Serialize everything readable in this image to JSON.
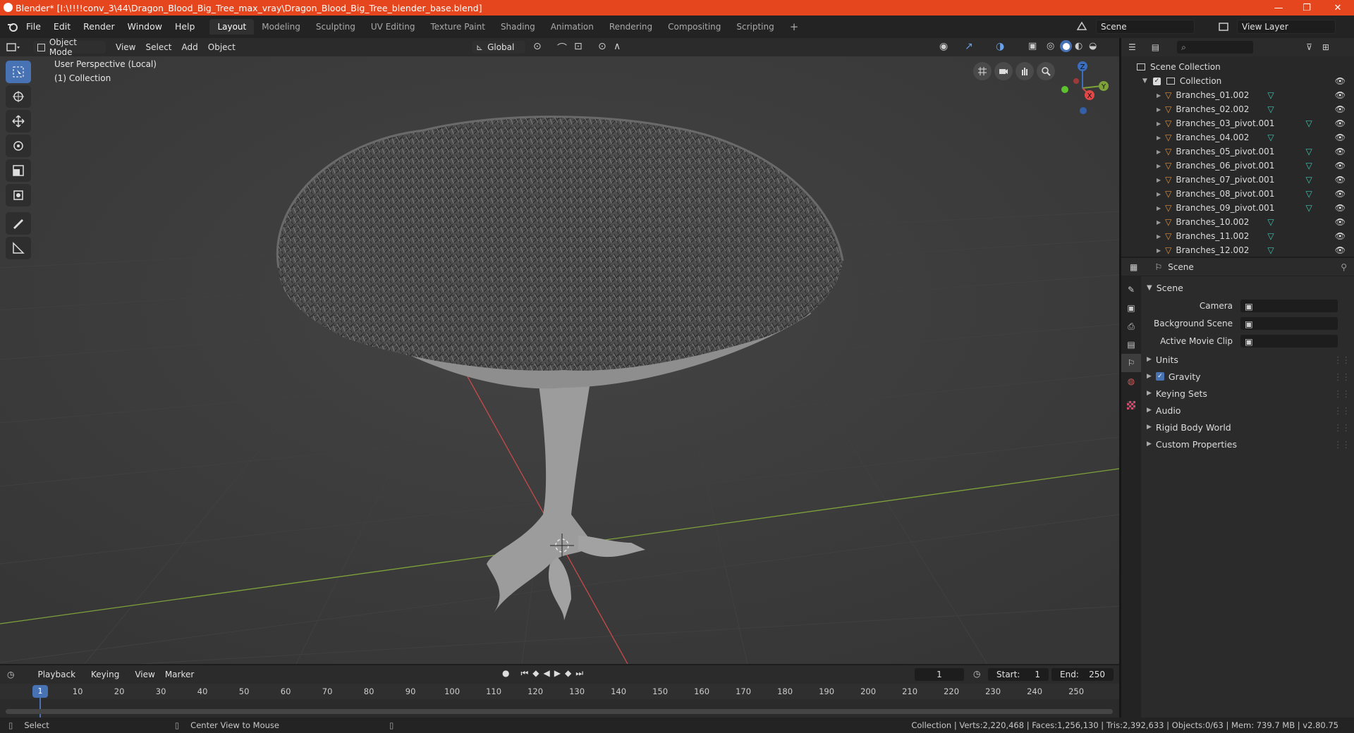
{
  "title": "Blender* [I:\\!!!!conv_3\\44\\Dragon_Blood_Big_Tree_max_vray\\Dragon_Blood_Big_Tree_blender_base.blend]",
  "window_controls": {
    "minimize": "—",
    "maximize": "❐",
    "close": "✕"
  },
  "menu": [
    "File",
    "Edit",
    "Render",
    "Window",
    "Help"
  ],
  "workspaces": [
    "Layout",
    "Modeling",
    "Sculpting",
    "UV Editing",
    "Texture Paint",
    "Shading",
    "Animation",
    "Rendering",
    "Compositing",
    "Scripting"
  ],
  "workspace_add": "+",
  "scene_name": "Scene",
  "view_layer": "View Layer",
  "viewport_header": {
    "mode": "Object Mode",
    "menus": [
      "View",
      "Select",
      "Add",
      "Object"
    ],
    "orientation": "Global"
  },
  "viewport": {
    "perspective": "User Perspective (Local)",
    "collection": "(1) Collection",
    "gizmo": {
      "z": "Z",
      "y": "Y",
      "x": "X"
    }
  },
  "outliner": {
    "root": "Scene Collection",
    "collection": "Collection",
    "items": [
      "Branches_01.002",
      "Branches_02.002",
      "Branches_03_pivot.001",
      "Branches_04.002",
      "Branches_05_pivot.001",
      "Branches_06_pivot.001",
      "Branches_07_pivot.001",
      "Branches_08_pivot.001",
      "Branches_09_pivot.001",
      "Branches_10.002",
      "Branches_11.002",
      "Branches_12.002"
    ]
  },
  "properties": {
    "context": "Scene",
    "panel": "Scene",
    "fields": [
      {
        "label": "Camera",
        "value": ""
      },
      {
        "label": "Background Scene",
        "value": ""
      },
      {
        "label": "Active Movie Clip",
        "value": ""
      }
    ],
    "sections": [
      "Units",
      "Gravity",
      "Keying Sets",
      "Audio",
      "Rigid Body World",
      "Custom Properties"
    ],
    "gravity_enabled": true
  },
  "timeline": {
    "menus": [
      "Playback",
      "Keying",
      "View",
      "Marker"
    ],
    "current_frame": "1",
    "start_label": "Start:",
    "start": "1",
    "end_label": "End:",
    "end": "250",
    "ticks": [
      "1",
      "10",
      "20",
      "30",
      "40",
      "50",
      "60",
      "70",
      "80",
      "90",
      "100",
      "110",
      "120",
      "130",
      "140",
      "150",
      "160",
      "170",
      "180",
      "190",
      "200",
      "210",
      "220",
      "230",
      "240",
      "250"
    ]
  },
  "status": {
    "left_action": "Select",
    "middle_action": "Center View to Mouse",
    "stats": "Collection | Verts:2,220,468 | Faces:1,256,130 | Tris:2,392,633 | Objects:0/63 | Mem: 739.7 MB | v2.80.75"
  },
  "colors": {
    "accent": "#4772b3",
    "titlebar": "#e6461e",
    "x_axis": "#c84a4a",
    "y_axis": "#7ea13a",
    "mesh_icon": "#e1913f",
    "data_icon": "#3fc6b0"
  }
}
